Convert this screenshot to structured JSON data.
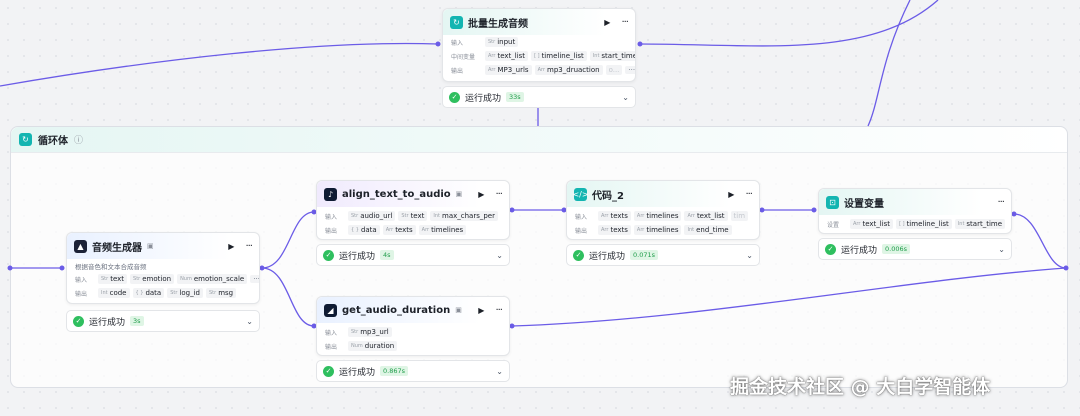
{
  "labels": {
    "input": "输入",
    "output": "输出",
    "intermediate": "中间变量",
    "settings": "设置"
  },
  "status": {
    "success": "运行成功"
  },
  "batch_node": {
    "title": "批量生成音频",
    "inputs": [
      "input"
    ],
    "intermediates": [
      "text_list",
      "timeline_list",
      "start_time"
    ],
    "outputs": [
      "MP3_urls",
      "mp3_druaction"
    ],
    "faded": "o...",
    "more": "···",
    "time": "33s"
  },
  "loop": {
    "title": "循环体"
  },
  "audio_gen_node": {
    "title": "音频生成器",
    "desc": "根据音色和文本合成音频",
    "inputs": [
      "text",
      "emotion",
      "emotion_scale"
    ],
    "outputs": [
      "code",
      "data",
      "log_id",
      "msg"
    ],
    "more": "···",
    "time": "3s"
  },
  "align_node": {
    "title": "align_text_to_audio",
    "inputs": [
      "audio_url",
      "text",
      "max_chars_per"
    ],
    "outputs": [
      "data",
      "texts",
      "timelines"
    ],
    "time": "4s"
  },
  "duration_node": {
    "title": "get_audio_duration",
    "inputs": [
      "mp3_url"
    ],
    "outputs": [
      "duration"
    ],
    "time": "0.867s"
  },
  "code_node": {
    "title": "代码_2",
    "inputs": [
      "texts",
      "timelines",
      "text_list"
    ],
    "input_faded": "tim",
    "outputs": [
      "texts",
      "timelines",
      "end_time"
    ],
    "time": "0.071s"
  },
  "setvar_node": {
    "title": "设置变量",
    "settings": [
      "text_list",
      "timeline_list",
      "start_time"
    ],
    "time": "0.006s"
  },
  "watermark": "掘金技术社区 @ 大白学智能体",
  "colors": {
    "edge": "#6b5ce7",
    "accent": "#13b5b1",
    "success": "#2fbf5f"
  }
}
